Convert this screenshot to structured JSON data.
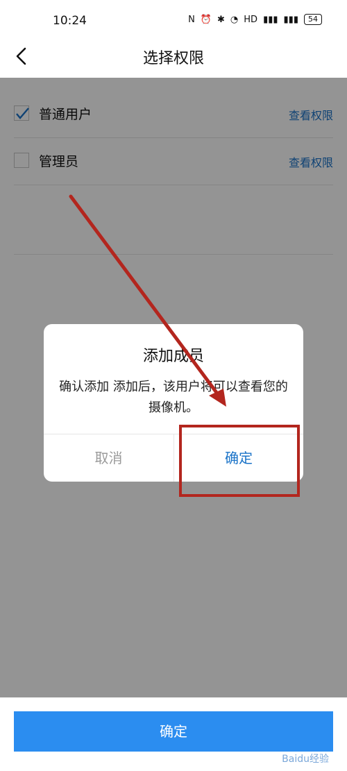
{
  "status_bar": {
    "time": "10:24",
    "battery": "54",
    "icons": [
      "nfc-icon",
      "alarm-icon",
      "bluetooth-icon",
      "wifi-icon",
      "hd-icon",
      "signal-5g-icon",
      "signal-4g-icon",
      "battery-icon"
    ]
  },
  "header": {
    "title": "选择权限"
  },
  "roles": [
    {
      "label": "普通用户",
      "link": "查看权限",
      "checked": true
    },
    {
      "label": "管理员",
      "link": "查看权限",
      "checked": false
    }
  ],
  "dialog": {
    "title": "添加成员",
    "message": "确认添加 添加后，该用户将可以查看您的摄像机。",
    "cancel": "取消",
    "confirm": "确定"
  },
  "bottom_button": {
    "label": "确定"
  },
  "watermark": "Baidu经验",
  "colors": {
    "accent": "#1a73c8",
    "button": "#2b8df0",
    "annotation": "#b3261e"
  }
}
